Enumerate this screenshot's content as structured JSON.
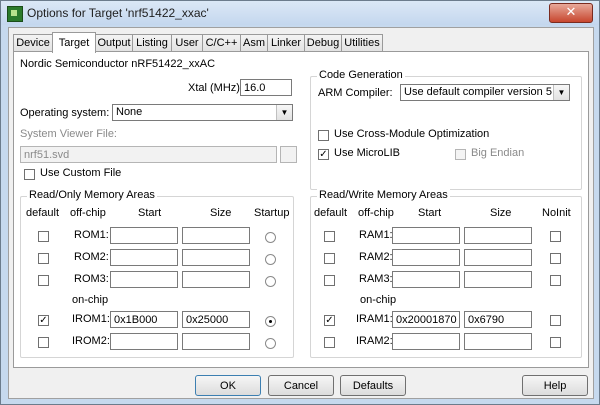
{
  "window": {
    "title": "Options for Target 'nrf51422_xxac'",
    "close_glyph": "✕"
  },
  "tabs": [
    {
      "label": "Device"
    },
    {
      "label": "Target"
    },
    {
      "label": "Output"
    },
    {
      "label": "Listing"
    },
    {
      "label": "User"
    },
    {
      "label": "C/C++"
    },
    {
      "label": "Asm"
    },
    {
      "label": "Linker"
    },
    {
      "label": "Debug"
    },
    {
      "label": "Utilities"
    }
  ],
  "active_tab": "Target",
  "device_name": "Nordic Semiconductor nRF51422_xxAC",
  "xtal": {
    "label": "Xtal (MHz):",
    "value": "16.0"
  },
  "os": {
    "label": "Operating system:",
    "value": "None"
  },
  "svf": {
    "label": "System Viewer File:",
    "value": "nrf51.svd"
  },
  "use_custom_file": {
    "label": "Use Custom File",
    "checked": false
  },
  "codegen": {
    "title": "Code Generation",
    "compiler_label": "ARM Compiler:",
    "compiler_value": "Use default compiler version 5",
    "cross_module": {
      "label": "Use Cross-Module Optimization",
      "checked": false
    },
    "microlib": {
      "label": "Use MicroLIB",
      "checked": true,
      "mark": "✓"
    },
    "big_endian": {
      "label": "Big Endian",
      "checked": false
    }
  },
  "rom": {
    "title": "Read/Only Memory Areas",
    "headers": {
      "default": "default",
      "offchip": "off-chip",
      "start": "Start",
      "size": "Size",
      "last": "Startup"
    },
    "onchip_label": "on-chip",
    "rows": [
      {
        "label": "ROM1:",
        "start": "",
        "size": "",
        "checked": false,
        "radio": false
      },
      {
        "label": "ROM2:",
        "start": "",
        "size": "",
        "checked": false,
        "radio": false
      },
      {
        "label": "ROM3:",
        "start": "",
        "size": "",
        "checked": false,
        "radio": false
      },
      {
        "label": "IROM1:",
        "start": "0x1B000",
        "size": "0x25000",
        "checked": true,
        "radio": true,
        "mark": "✓"
      },
      {
        "label": "IROM2:",
        "start": "",
        "size": "",
        "checked": false,
        "radio": false
      }
    ]
  },
  "ram": {
    "title": "Read/Write Memory Areas",
    "headers": {
      "default": "default",
      "offchip": "off-chip",
      "start": "Start",
      "size": "Size",
      "last": "NoInit"
    },
    "onchip_label": "on-chip",
    "rows": [
      {
        "label": "RAM1:",
        "start": "",
        "size": "",
        "checked": false
      },
      {
        "label": "RAM2:",
        "start": "",
        "size": "",
        "checked": false
      },
      {
        "label": "RAM3:",
        "start": "",
        "size": "",
        "checked": false
      },
      {
        "label": "IRAM1:",
        "start": "0x20001870",
        "size": "0x6790",
        "checked": true,
        "mark": "✓"
      },
      {
        "label": "IRAM2:",
        "start": "",
        "size": "",
        "checked": false
      }
    ]
  },
  "buttons": {
    "ok": "OK",
    "cancel": "Cancel",
    "defaults": "Defaults",
    "help": "Help"
  },
  "dropdown_glyph": "▼"
}
